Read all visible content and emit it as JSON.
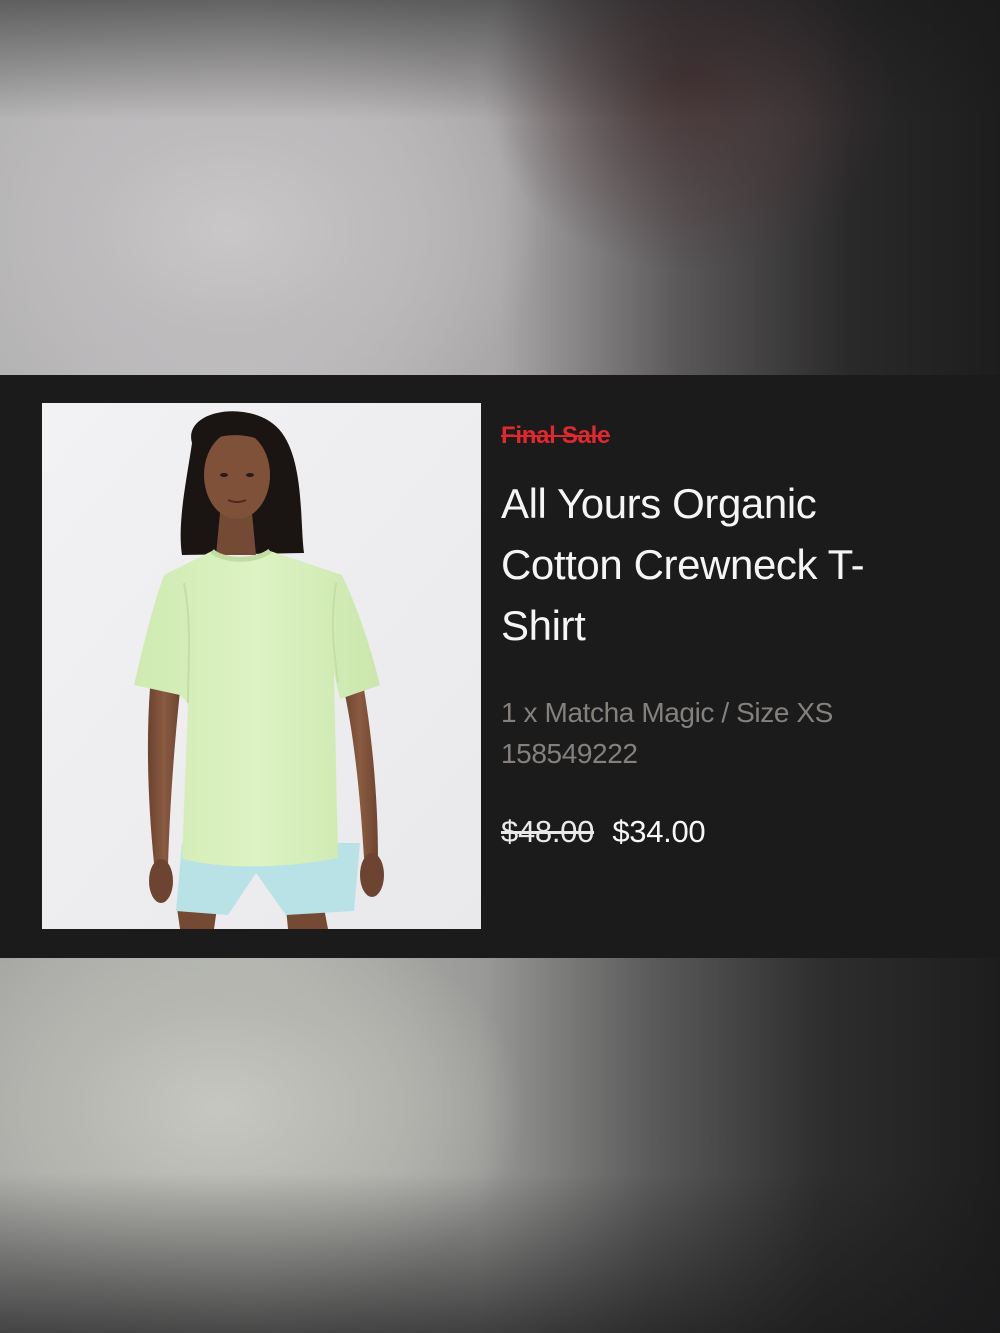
{
  "order_item": {
    "badge": "Final Sale",
    "title": "All Yours Organic Cotton Crewneck T-Shirt",
    "title_display": "All Yours Organic\nCotton Crewneck T-\nShirt",
    "variant": "1 x Matcha Magic / Size XS",
    "item_number": "158549222",
    "original_price": "$48.00",
    "sale_price": "$34.00"
  },
  "colors": {
    "badge": "#e0282e",
    "card_background": "#1b1b1c",
    "muted_text": "#85807c",
    "shirt": "#d7f0bb",
    "shorts": "#b8e2e6"
  }
}
